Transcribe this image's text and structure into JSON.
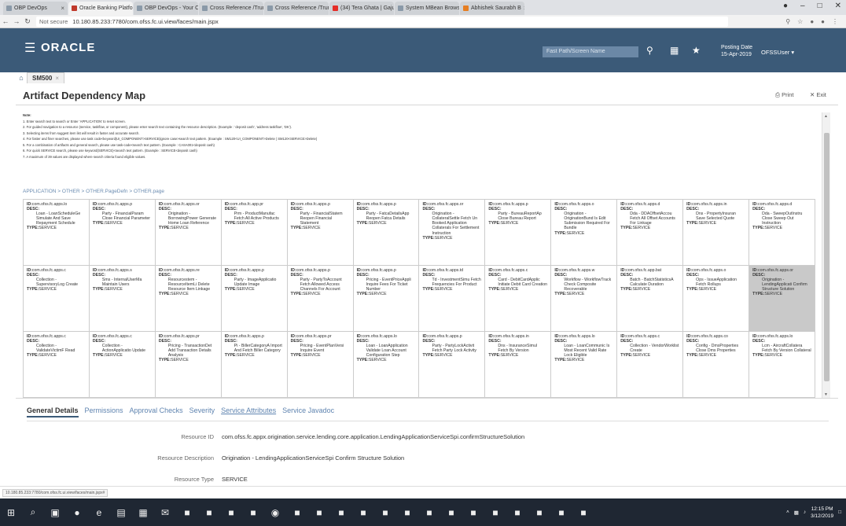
{
  "browser": {
    "tabs": [
      {
        "label": "OBP DevOps",
        "color": "#8a99a8",
        "active": false
      },
      {
        "label": "Oracle Banking Platfo",
        "color": "#c0392b",
        "active": true
      },
      {
        "label": "OBP DevOps - Your Cr",
        "color": "#8a99a8",
        "active": false
      },
      {
        "label": "Cross Reference /Trur",
        "color": "#8a99a8",
        "active": false
      },
      {
        "label": "Cross Reference /Trur",
        "color": "#8a99a8",
        "active": false
      },
      {
        "label": "(34) Tera Ghata | Gaju",
        "color": "#e52d27",
        "active": false
      },
      {
        "label": "System MBean Brows",
        "color": "#8a99a8",
        "active": false
      },
      {
        "label": "Abhishek Saurabh B",
        "color": "#e67e22",
        "active": false
      }
    ],
    "not_secure": "Not secure",
    "url": "10.180.85.233:7780/com.ofss.fc.ui.view/faces/main.jspx",
    "status_url": "10.180.85.233:7780/com.ofss.fc.ui.view/faces/main.jspx#"
  },
  "header": {
    "logo": "ORACLE",
    "fast_path_placeholder": "Fast Path/Screen Name",
    "posting_date_label": "Posting Date",
    "posting_date": "15-Apr-2019",
    "user": "OFSSUser"
  },
  "app_tab": {
    "label": "SM500"
  },
  "page": {
    "title": "Artifact Dependency Map",
    "print_label": "Print",
    "exit_label": "Exit",
    "breadcrumb": "APPLICATION > OTHER > OTHER.PageDefn > OTHER.page"
  },
  "notes": [
    "Note:",
    "1. Enter search text to search or Enter 'APPLICATION' to reset screen.",
    "2. For guided navigation to a resource (service, taskflow, or component), please enter search text containing the resource description. (Example : 'deposit cash', 'address taskflow', 'DK').",
    "3. Selecting items from suggest item list will result in faster and accurate search.",
    "4. For faster and finer searches, please use task code<keyword|UI_COMPONENT>SERVICE|ignore case>search text pattern. (Example : SM120<UI_COMPONENT>Delete | SM120<SERVICE>Delete)",
    "5. For a combination of artifacts and general search, please use task-code<search text pattern. (Example : CASA001<deposit cash)",
    "6. For quick SERVICE search, please use keyword(SERVICE)<search text pattern. (Example : SERVICE<deposit cash)",
    "7. A maximum of 39 values are displayed where search criteria found eligible values."
  ],
  "grid_labels": {
    "id": "ID:",
    "desc": "DESC:",
    "type": "TYPE:"
  },
  "cells": [
    {
      "id": "com.ofss.fc.apps.lo",
      "desc": "Loan - LoanScheduleGe Simulate And Save Repayment Schedule",
      "type": "SERVICE",
      "selected": false
    },
    {
      "id": "com.ofss.fc.apps.p",
      "desc": "Party - FinancialParam Close Financial Parameter",
      "type": "SERVICE",
      "selected": false
    },
    {
      "id": "com.ofss.fc.apps.or",
      "desc": "Origination - BorrowingPower Generate Home Loan Reference",
      "type": "SERVICE",
      "selected": false
    },
    {
      "id": "com.ofss.fc.app.pr",
      "desc": "Prm - ProductManufac Fetch All Active Products",
      "type": "SERVICE",
      "selected": false
    },
    {
      "id": "com.ofss.fc.apps.p",
      "desc": "Party - FinancialStatem Reopen Financial Statement",
      "type": "SERVICE",
      "selected": false
    },
    {
      "id": "com.ofss.fc.apps.p",
      "desc": "Party - FatcaDetailsApp Reopen Fatca Details",
      "type": "SERVICE",
      "selected": false
    },
    {
      "id": "com.ofss.fc.apps.or",
      "desc": "Origination - CollateralSettle Fetch Un Booked Application Collaterals For Settlement Instruction",
      "type": "SERVICE",
      "selected": false
    },
    {
      "id": "com.ofss.fc.apps.p",
      "desc": "Party - BureauReportAp Close Bureau Report",
      "type": "SERVICE",
      "selected": false
    },
    {
      "id": "com.ofss.fc.apps.o",
      "desc": "Origination - OriginationBund Is Edit Submission Required For Bundle",
      "type": "SERVICE",
      "selected": false
    },
    {
      "id": "com.ofss.fc.apps.d",
      "desc": "Dda - DDAOffsetAccou Fetch All Offset Accounts For Linkage",
      "type": "SERVICE",
      "selected": false
    },
    {
      "id": "com.ofss.fc.apps.in",
      "desc": "Dns - PropertyInsuran Save Selected Quote",
      "type": "SERVICE",
      "selected": false
    },
    {
      "id": "com.ofss.fc.apps.d",
      "desc": "Dda - SweepOutInstru Close Sweep Out Instruction",
      "type": "SERVICE",
      "selected": false
    },
    {
      "id": "com.ofss.fc.apps.c",
      "desc": "Collection - SupervisoryLog Create",
      "type": "SERVICE",
      "selected": false
    },
    {
      "id": "com.ofss.fc.apps.s",
      "desc": "Sms - InternalUserMa Maintain Users",
      "type": "SERVICE",
      "selected": false
    },
    {
      "id": "com.ofss.fc.apps.re",
      "desc": "Resourcestem - ResourceItemLi Delete Resource Item Linkage",
      "type": "SERVICE",
      "selected": false
    },
    {
      "id": "com.ofss.fc.apps.p",
      "desc": "Party - ImageApplicatio Update Image",
      "type": "SERVICE",
      "selected": false
    },
    {
      "id": "com.ofss.fc.apps.p",
      "desc": "Party - PartyToAccount Fetch Allowed Access Channels For Account",
      "type": "SERVICE",
      "selected": false
    },
    {
      "id": "com.ofss.fc.apps.p",
      "desc": "Pricing - EventPriceAppli Inquire Fees For Ticket Number",
      "type": "SERVICE",
      "selected": false
    },
    {
      "id": "com.ofss.fc.apps.td",
      "desc": "Td - InvestmentSimu Fetch Frequencies For Product",
      "type": "SERVICE",
      "selected": false
    },
    {
      "id": "com.ofss.fc.apps.c",
      "desc": "Card - DebitCardApplic Initiate Debit Card Creation",
      "type": "SERVICE",
      "selected": false
    },
    {
      "id": "com.ofss.fc.apps.w",
      "desc": "Workflow - WorkflowTrack Check Composite Recoverable",
      "type": "SERVICE",
      "selected": false
    },
    {
      "id": "com.ofss.fc.app.bat",
      "desc": "Batch - BatchStatisticsA Calculate Duration",
      "type": "SERVICE",
      "selected": false
    },
    {
      "id": "com.ofss.fc.apps.o",
      "desc": "Ops - IssueApplication Fetch Rollups",
      "type": "SERVICE",
      "selected": false
    },
    {
      "id": "com.ofss.fc.apps.or",
      "desc": "Origination - LendingApplicati Confirm Structure Solution",
      "type": "SERVICE",
      "selected": true
    },
    {
      "id": "com.ofss.fc.apps.c",
      "desc": "Collection - ValidateVictimF Read",
      "type": "SERVICE",
      "selected": false
    },
    {
      "id": "com.ofss.fc.apps.c",
      "desc": "Collection - ActionApplicatio Update",
      "type": "SERVICE",
      "selected": false
    },
    {
      "id": "com.ofss.fc.apps.pr",
      "desc": "Pricing - TransactionDet Add Transaction Details Analysis",
      "type": "SERVICE",
      "selected": false
    },
    {
      "id": "com.ofss.fc.apps.p",
      "desc": "Pi - BillerCategoryA Import And Fetch Biller Category",
      "type": "SERVICE",
      "selected": false
    },
    {
      "id": "com.ofss.fc.apps.pr",
      "desc": "Pricing - EventPlanVersi Inquire Event",
      "type": "SERVICE",
      "selected": false
    },
    {
      "id": "com.ofss.fc.apps.lo",
      "desc": "Loan - LoanApplication Validate Loan Account Configuration Step",
      "type": "SERVICE",
      "selected": false
    },
    {
      "id": "com.ofss.fc.apps.p",
      "desc": "Party - PartyLockActivit Fetch Party Lock Activity",
      "type": "SERVICE",
      "selected": false
    },
    {
      "id": "com.ofss.fc.apps.in",
      "desc": "Dns - InsuranceSimul Fetch By Version",
      "type": "SERVICE",
      "selected": false
    },
    {
      "id": "com.ofss.fc.apps.lo",
      "desc": "Loan - LoanCommunic Is Most Recent Valid Rate Lock Eligible",
      "type": "SERVICE",
      "selected": false
    },
    {
      "id": "com.ofss.fc.apps.c",
      "desc": "Collection - VendorWorklist Create",
      "type": "SERVICE",
      "selected": false
    },
    {
      "id": "com.ofss.fc.apps.co",
      "desc": "Config - DmsProperties Close Dms Properties",
      "type": "SERVICE",
      "selected": false
    },
    {
      "id": "com.ofss.fc.apps.lo",
      "desc": "Lcm - AircraftCollatera Fetch By Version Collateral",
      "type": "SERVICE",
      "selected": false
    }
  ],
  "details": {
    "tabs": [
      {
        "label": "General Details",
        "active": true,
        "underline": false
      },
      {
        "label": "Permissions",
        "active": false,
        "underline": false
      },
      {
        "label": "Approval Checks",
        "active": false,
        "underline": false
      },
      {
        "label": "Severity",
        "active": false,
        "underline": false
      },
      {
        "label": "Service Attributes",
        "active": false,
        "underline": true
      },
      {
        "label": "Service Javadoc",
        "active": false,
        "underline": false
      }
    ],
    "resource_id_label": "Resource ID",
    "resource_id": "com.ofss.fc.appx.origination.service.lending.core.application.LendingApplicationServiceSpi.confirmStructureSolution",
    "resource_desc_label": "Resource Description",
    "resource_desc": "Origination - LendingApplicationServiceSpi Confirm Structure Solution",
    "resource_type_label": "Resource Type",
    "resource_type": "SERVICE"
  },
  "taskbar": {
    "time": "12:15 PM",
    "date": "3/12/2019",
    "icons": [
      "windows-icon",
      "search-icon",
      "task-view-icon",
      "firefox-icon",
      "edge-icon",
      "file-explorer-icon",
      "store-icon",
      "mail-icon",
      "app-icon",
      "app-icon",
      "app-icon",
      "app-icon",
      "chrome-icon",
      "app-icon",
      "app-icon",
      "app-icon",
      "pdf-icon",
      "app-icon",
      "app-icon",
      "app-icon",
      "app-icon",
      "app-icon",
      "app-icon",
      "app-icon",
      "app-icon",
      "app-icon",
      "app-icon"
    ]
  }
}
